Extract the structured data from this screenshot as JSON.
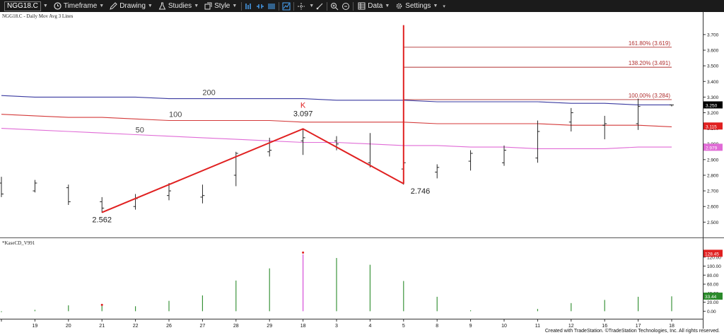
{
  "toolbar": {
    "symbol": "NGG18.C",
    "timeframe": "Timeframe",
    "drawing": "Drawing",
    "studies": "Studies",
    "style": "Style",
    "data": "Data",
    "settings": "Settings"
  },
  "chart_title": "NGG18.C - Daily  Mov Avg 3 Lines",
  "footer": "Created with TradeStation. ©TradeStation Technologies, Inc. All rights reserved.",
  "colors": {
    "toolbar_bg": "#1b1b1b",
    "ma200": "#3a3aa0",
    "ma100": "#d43a3a",
    "ma50": "#e06bd6",
    "fib": "#b03030",
    "wave": "#e02020",
    "bar_up": "#2a8a2a",
    "bar_down": "#d23fd6"
  },
  "chart_data": [
    {
      "type": "ohlc",
      "title": "NGG18.C - Daily  Mov Avg 3 Lines",
      "categories": [
        "",
        "19",
        "20",
        "21",
        "22",
        "26",
        "27",
        "28",
        "29",
        "18",
        "3",
        "4",
        "5",
        "8",
        "9",
        "10",
        "11",
        "12",
        "16",
        "17",
        "18"
      ],
      "ohlc": [
        [
          2.75,
          2.79,
          2.66,
          2.68
        ],
        [
          2.7,
          2.77,
          2.69,
          2.75
        ],
        [
          2.72,
          2.74,
          2.61,
          2.63
        ],
        [
          2.63,
          2.66,
          2.56,
          2.59
        ],
        [
          2.6,
          2.68,
          2.58,
          2.65
        ],
        [
          2.67,
          2.75,
          2.64,
          2.7
        ],
        [
          2.66,
          2.74,
          2.62,
          2.67
        ],
        [
          2.8,
          2.95,
          2.73,
          2.94
        ],
        [
          2.95,
          3.04,
          2.92,
          2.96
        ],
        [
          3.02,
          3.1,
          2.93,
          3.04
        ],
        [
          3.02,
          3.05,
          2.96,
          3.0
        ],
        [
          2.88,
          3.07,
          2.85,
          2.86
        ],
        [
          2.84,
          3.76,
          2.74,
          2.88
        ],
        [
          2.82,
          2.87,
          2.78,
          2.85
        ],
        [
          2.89,
          2.96,
          2.83,
          2.94
        ],
        [
          2.88,
          2.99,
          2.86,
          2.96
        ],
        [
          2.91,
          3.15,
          2.88,
          3.08
        ],
        [
          3.14,
          3.23,
          3.08,
          3.2
        ],
        [
          3.12,
          3.18,
          3.03,
          3.13
        ],
        [
          3.13,
          3.29,
          3.09,
          3.24
        ],
        [
          3.25,
          3.25,
          3.24,
          3.25
        ]
      ],
      "ylim": [
        2.42,
        3.79
      ],
      "yticks": [
        2.5,
        2.6,
        2.7,
        2.8,
        2.9,
        3.0,
        3.1,
        3.2,
        3.3,
        3.4,
        3.5,
        3.6,
        3.7
      ],
      "ytick_labels": [
        "2.500",
        "2.600",
        "2.700",
        "2.800",
        "2.900",
        "3.000",
        "3.100",
        "3.200",
        "3.300",
        "3.400",
        "3.500",
        "3.600",
        "3.700"
      ],
      "moving_averages": [
        {
          "name": "200",
          "values": [
            3.31,
            3.3,
            3.3,
            3.3,
            3.3,
            3.29,
            3.29,
            3.29,
            3.29,
            3.29,
            3.28,
            3.28,
            3.28,
            3.27,
            3.27,
            3.27,
            3.27,
            3.26,
            3.26,
            3.25,
            3.25
          ]
        },
        {
          "name": "100",
          "values": [
            3.19,
            3.18,
            3.17,
            3.17,
            3.16,
            3.15,
            3.15,
            3.15,
            3.15,
            3.14,
            3.14,
            3.14,
            3.14,
            3.13,
            3.13,
            3.13,
            3.13,
            3.12,
            3.12,
            3.12,
            3.11
          ]
        },
        {
          "name": "50",
          "values": [
            3.1,
            3.09,
            3.08,
            3.07,
            3.06,
            3.05,
            3.04,
            3.03,
            3.02,
            3.01,
            3.01,
            3.0,
            2.99,
            2.99,
            2.98,
            2.98,
            2.97,
            2.97,
            2.97,
            2.98,
            2.98
          ]
        }
      ],
      "ma_labels": [
        {
          "text": "200",
          "x_index": 6.0,
          "y": 3.3
        },
        {
          "text": "100",
          "x_index": 5.0,
          "y": 3.16
        },
        {
          "text": "50",
          "x_index": 4.0,
          "y": 3.06
        }
      ],
      "last_values": [
        {
          "text": "3.250",
          "value": 3.25,
          "color": "#000000",
          "text_color": "#ffffff"
        },
        {
          "text": "3.115",
          "value": 3.115,
          "color": "#e02020",
          "text_color": "#ffffff"
        },
        {
          "text": "2.979",
          "value": 2.979,
          "color": "#e06bd6",
          "text_color": "#ffffff"
        }
      ],
      "wave": {
        "points": [
          [
            3.0,
            2.562
          ],
          [
            9.0,
            3.097
          ],
          [
            12.0,
            2.746
          ]
        ],
        "labels": [
          {
            "text": "2.562",
            "x_index": 3.0,
            "value": 2.562,
            "pos": "below"
          },
          {
            "text": "K",
            "x_index": 9.0,
            "value": 3.097,
            "pos": "above2"
          },
          {
            "text": "3.097",
            "x_index": 9.0,
            "value": 3.097,
            "pos": "above"
          },
          {
            "text": "2.746",
            "x_index": 12.5,
            "value": 2.746,
            "pos": "below"
          }
        ],
        "spike": {
          "x_index": 12.0,
          "from": 2.746,
          "to": 3.76
        }
      },
      "fib_levels": [
        {
          "label": "161.80% (3.619)",
          "value": 3.619
        },
        {
          "label": "138.20% (3.491)",
          "value": 3.491
        },
        {
          "label": "100.00% (3.284)",
          "value": 3.284
        }
      ]
    },
    {
      "type": "bar",
      "title": "*KaseCD_V991",
      "categories": [
        "",
        "19",
        "20",
        "21",
        "22",
        "26",
        "27",
        "28",
        "29",
        "18",
        "3",
        "4",
        "5",
        "8",
        "9",
        "10",
        "11",
        "12",
        "16",
        "17",
        "18"
      ],
      "values": [
        -2,
        3,
        13,
        12,
        11,
        23,
        35,
        68,
        95,
        126,
        118,
        103,
        67,
        32,
        2,
        0,
        5,
        18,
        25,
        32,
        33
      ],
      "highlight_index": 9,
      "markers": [
        {
          "x_index": 3,
          "value": 14,
          "color": "#e02020"
        },
        {
          "x_index": 9,
          "value": 130,
          "color": "#e02020"
        }
      ],
      "ylim": [
        -12,
        140
      ],
      "yticks": [
        0,
        20,
        40,
        60,
        80,
        100,
        120
      ],
      "ytick_labels": [
        "0.00",
        "20.00",
        "40.00",
        "60.00",
        "80.00",
        "100.00",
        "120.00"
      ],
      "last_values": [
        {
          "text": "128.45",
          "value": 128.45,
          "color": "#e02020",
          "text_color": "#ffffff"
        },
        {
          "text": "33.44",
          "value": 33.44,
          "color": "#2a8a2a",
          "text_color": "#ffffff"
        }
      ]
    }
  ]
}
